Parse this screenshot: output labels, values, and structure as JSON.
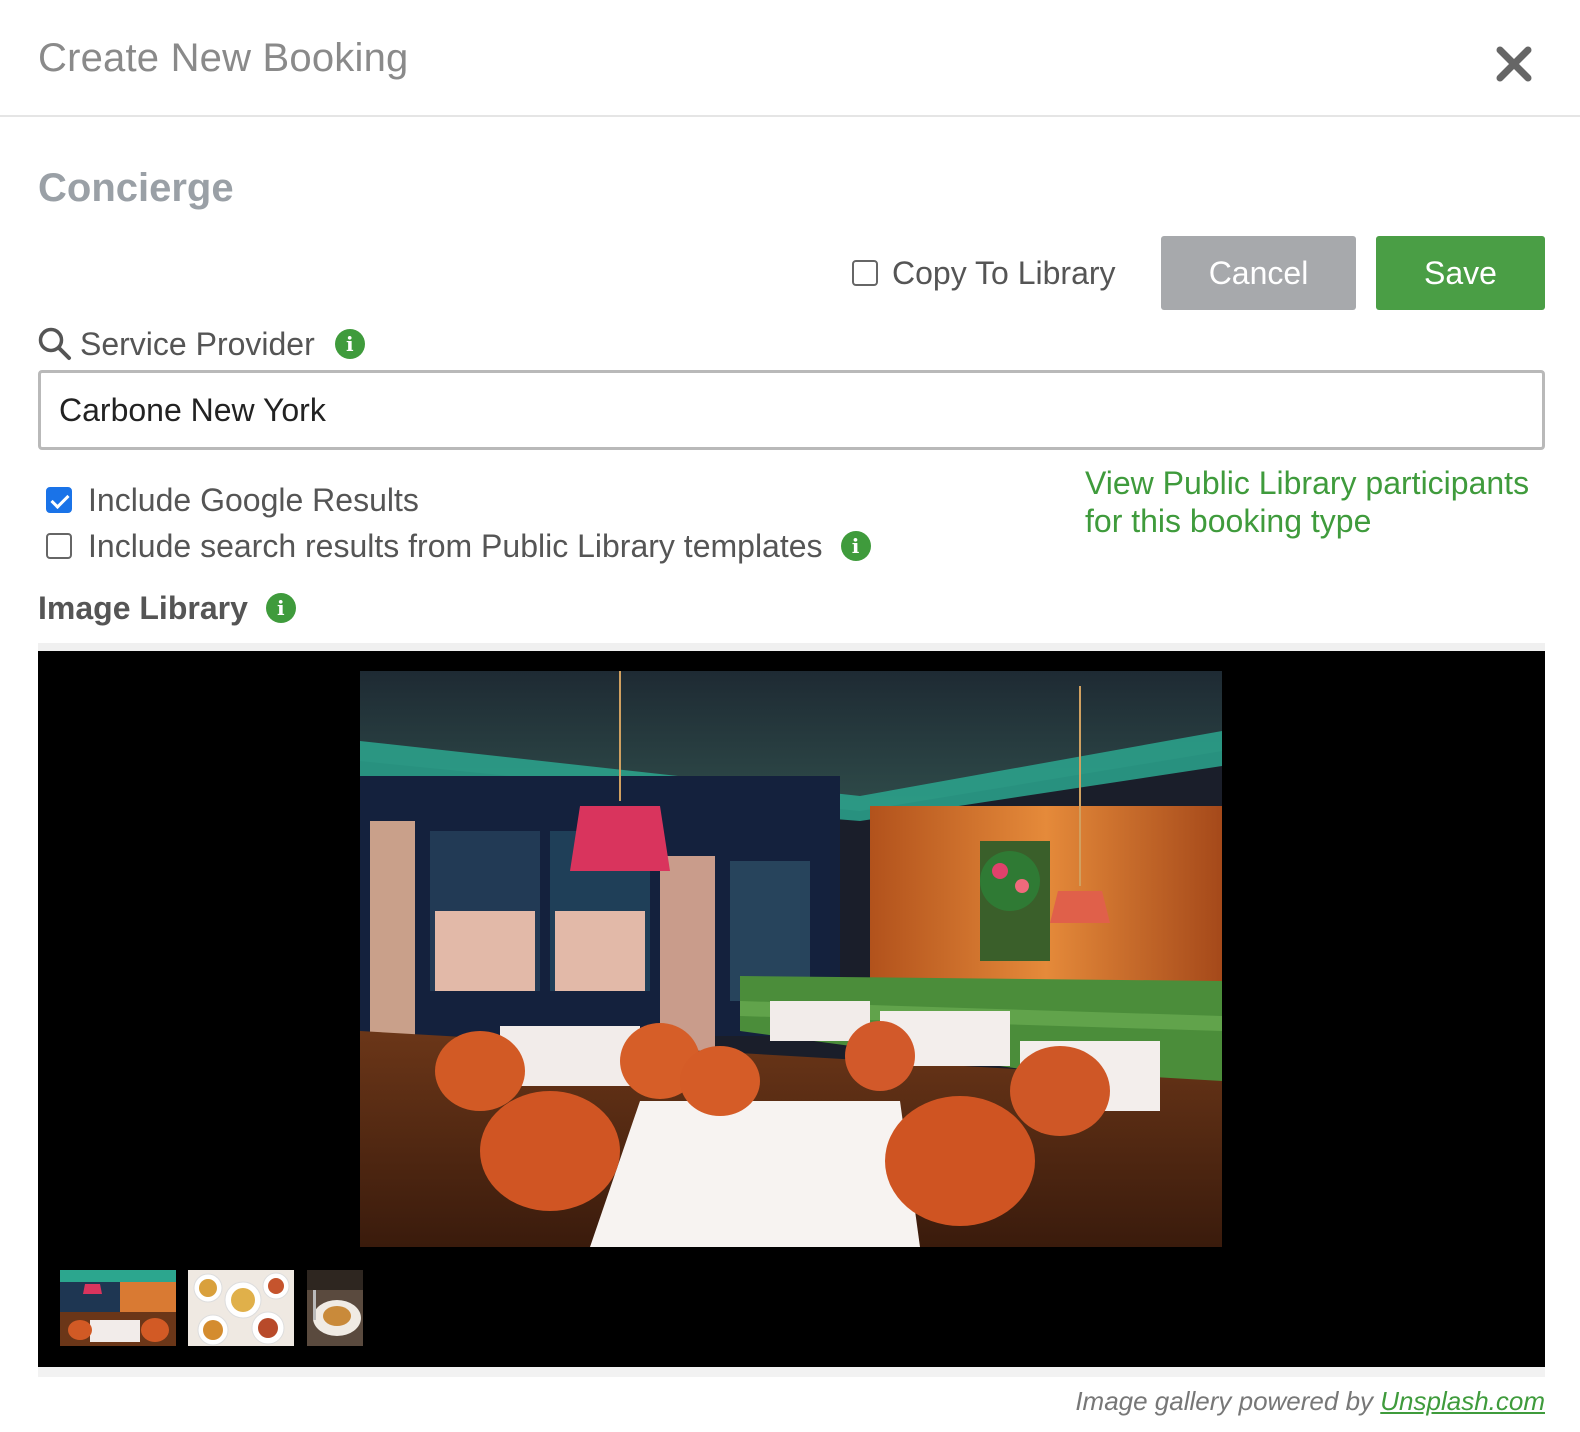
{
  "modal": {
    "title": "Create New Booking"
  },
  "section": {
    "title": "Concierge"
  },
  "actions": {
    "copy_to_library_label": "Copy To Library",
    "copy_to_library_checked": false,
    "cancel_label": "Cancel",
    "save_label": "Save"
  },
  "provider": {
    "label": "Service Provider",
    "value": "Carbone New York"
  },
  "options": {
    "google_label": "Include Google Results",
    "google_checked": true,
    "public_library_label": "Include search results from Public Library templates",
    "public_library_checked": false
  },
  "public_link": {
    "line1": "View Public Library participants",
    "line2": "for this booking type"
  },
  "image_library": {
    "title": "Image Library"
  },
  "footer": {
    "prefix": "Image gallery powered by ",
    "link": "Unsplash.com"
  },
  "colors": {
    "accent_green": "#3f9b3c",
    "save_green": "#4a9e45",
    "cancel_gray": "#a7a9ac",
    "checkbox_blue": "#1a73e8"
  },
  "icons": {
    "close": "close-icon",
    "search": "search-icon",
    "info": "info-icon"
  }
}
